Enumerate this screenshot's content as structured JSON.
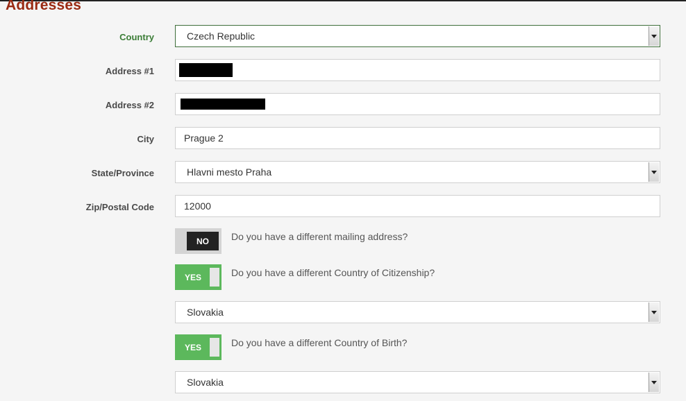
{
  "section_title": "Addresses",
  "country": {
    "label": "Country",
    "value": "Czech Republic"
  },
  "address1": {
    "label": "Address #1",
    "value": ""
  },
  "address2": {
    "label": "Address #2",
    "value": ""
  },
  "city": {
    "label": "City",
    "value": "Prague 2"
  },
  "state": {
    "label": "State/Province",
    "value": "Hlavni mesto Praha"
  },
  "zip": {
    "label": "Zip/Postal Code",
    "value": "12000"
  },
  "mailing": {
    "toggle": "NO",
    "question": "Do you have a different mailing address?"
  },
  "citizenship": {
    "toggle": "YES",
    "question": "Do you have a different Country of Citizenship?",
    "value": "Slovakia"
  },
  "birth": {
    "toggle": "YES",
    "question": "Do you have a different Country of Birth?",
    "value": "Slovakia"
  },
  "colors": {
    "title": "#9a2a12",
    "active_label": "#3b7d36",
    "toggle_yes": "#5cb85c",
    "toggle_no": "#222222"
  },
  "icons": {
    "select_arrow": "triangle-down-icon"
  }
}
